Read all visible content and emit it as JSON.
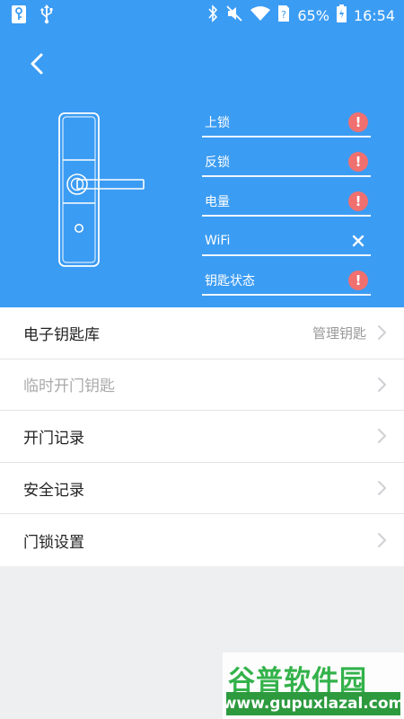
{
  "statusbar": {
    "battery": "65%",
    "time": "16:54",
    "icons": [
      "key-icon",
      "usb-icon",
      "bluetooth-icon",
      "mute-icon",
      "wifi-icon",
      "sim-unknown-icon",
      "battery-charging-icon"
    ]
  },
  "header": {
    "back_icon": "chevron-left-icon",
    "background_color": "#3b9cf3"
  },
  "lock_status": [
    {
      "label": "上锁",
      "icon": "alert-icon"
    },
    {
      "label": "反锁",
      "icon": "alert-icon"
    },
    {
      "label": "电量",
      "icon": "alert-icon"
    },
    {
      "label": "WiFi",
      "icon": "close-icon"
    },
    {
      "label": "钥匙状态",
      "icon": "alert-icon"
    }
  ],
  "alert_glyph": "!",
  "menu": [
    {
      "label": "电子钥匙库",
      "sub": "管理钥匙",
      "enabled": true
    },
    {
      "label": "临时开门钥匙",
      "sub": "",
      "enabled": false
    },
    {
      "label": "开门记录",
      "sub": "",
      "enabled": true
    },
    {
      "label": "安全记录",
      "sub": "",
      "enabled": true
    },
    {
      "label": "门锁设置",
      "sub": "",
      "enabled": true
    }
  ],
  "watermark": {
    "title": "谷普软件园",
    "url": "www.gupuxlazal.com"
  },
  "colors": {
    "accent_blue": "#3b9cf3",
    "alert_red": "#f07070",
    "watermark_green": "#33b24a"
  }
}
